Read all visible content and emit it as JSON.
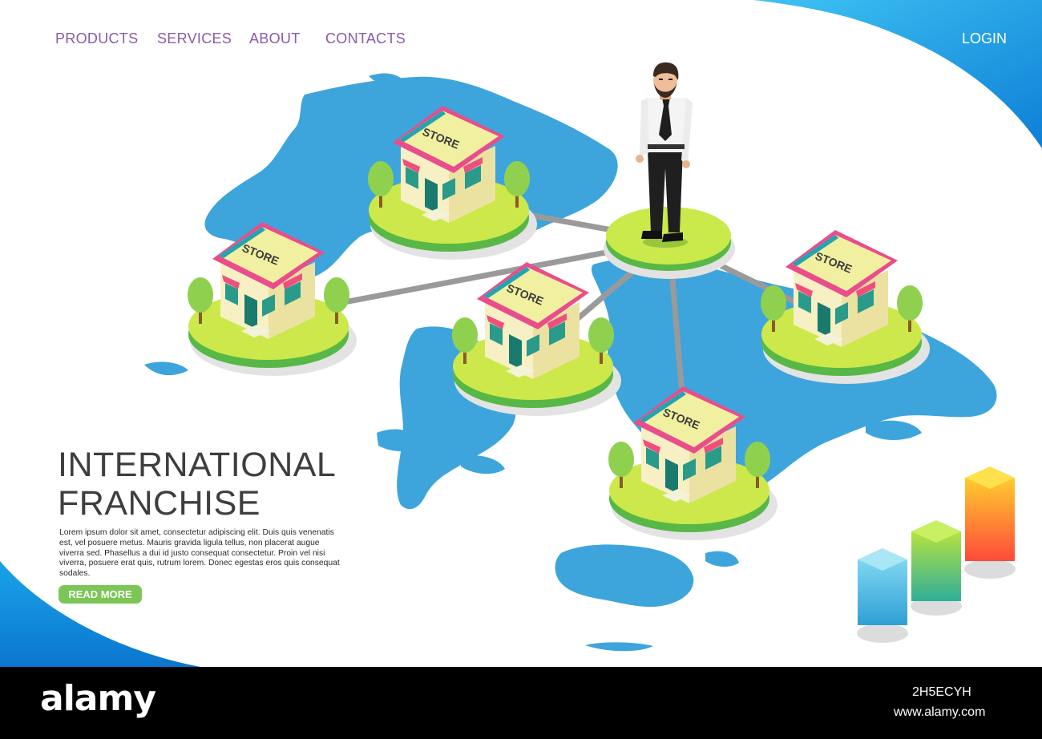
{
  "colors": {
    "accent_blue": "#1a9be0",
    "map_blue": "#3da5dc",
    "nav_purple": "#8a5aa6",
    "button_green": "#7cc655",
    "platform_green": "#b9e34b",
    "roof_pink": "#e94d8b",
    "headline": "#3e3e3e"
  },
  "nav": {
    "items": [
      {
        "label": "PRODUCTS"
      },
      {
        "label": "SERVICES"
      },
      {
        "label": "ABOUT"
      },
      {
        "label": "CONTACTS"
      }
    ],
    "login_label": "LOGIN"
  },
  "hero": {
    "title_line1": "INTERNATIONAL",
    "title_line2": "FRANCHISE",
    "body": "Lorem ipsum dolor sit amet, consectetur adipiscing elit. Duis quis venenatis est, vel posuere metus. Mauris gravida ligula tellus, non placerat augue viverra sed. Phasellus a dui id justo consequat consectetur. Proin vel nisi viverra, posuere erat quis, rutrum lorem. Donec egestas eros quis consequat sodales.",
    "cta_label": "READ MORE"
  },
  "illustration": {
    "store_sign": "STORE",
    "store_count": 5,
    "icons": [
      "world-map",
      "businessman",
      "store",
      "tree",
      "bar-chart"
    ]
  },
  "watermark": {
    "logo": "alamy",
    "image_id": "2H5ECYH",
    "url": "www.alamy.com"
  }
}
